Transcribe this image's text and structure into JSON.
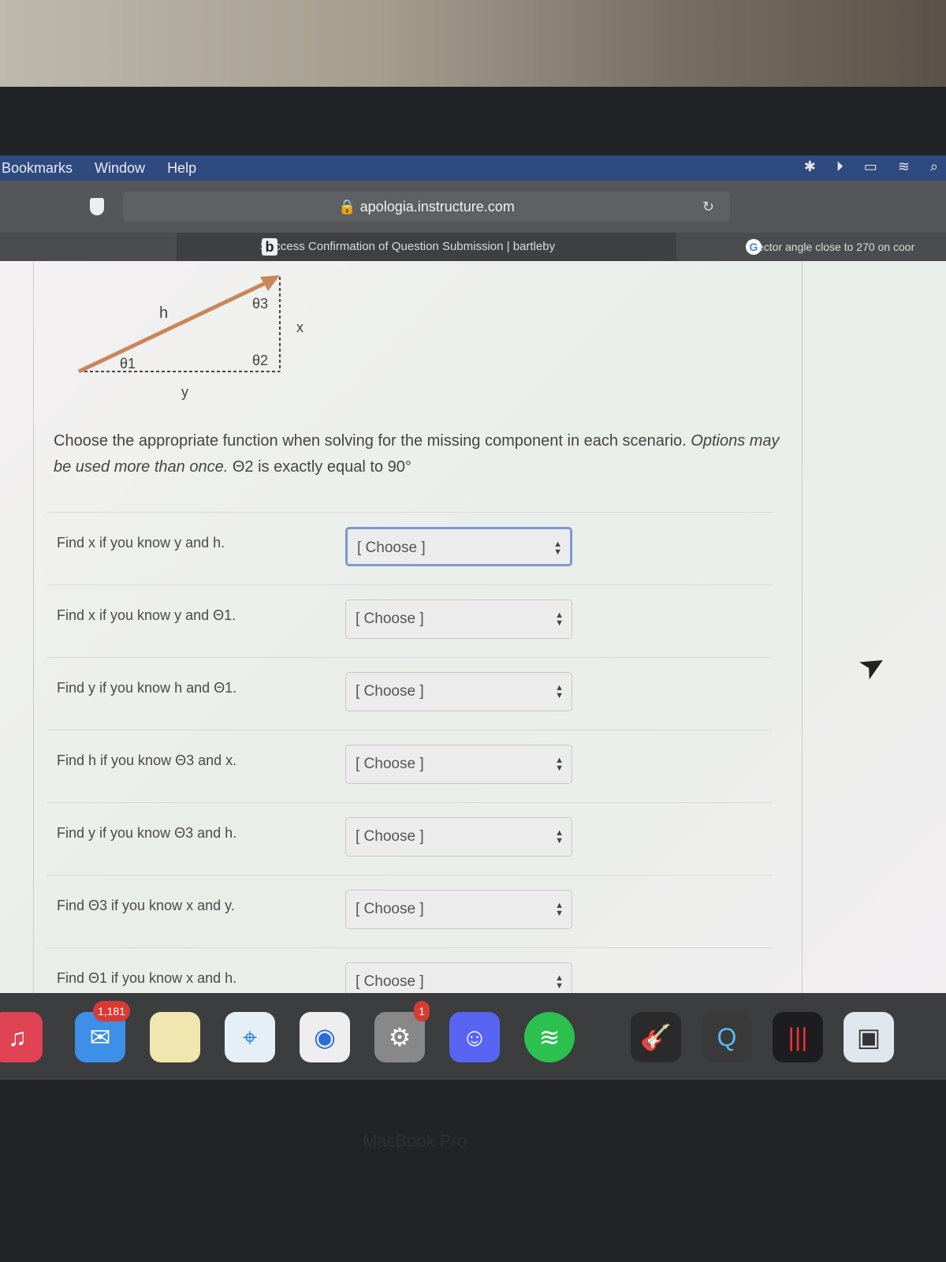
{
  "menubar": {
    "items": [
      "Bookmarks",
      "Window",
      "Help"
    ]
  },
  "browser": {
    "url": "apologia.instructure.com",
    "tabs": [
      {
        "title": "Success Confirmation of Question Submission | bartleby",
        "icon": "b"
      },
      {
        "title": "vector angle close to 270 on coor",
        "icon": "G"
      }
    ]
  },
  "diagram": {
    "h": "h",
    "theta1": "θ1",
    "theta2": "θ2",
    "theta3": "θ3",
    "x": "x",
    "y": "y",
    "arrow_color": "#c8875a"
  },
  "question": {
    "text": "Choose the appropriate function when solving for the missing component in each scenario.",
    "italic": "Options may be used more than once.",
    "tail": "Θ2 is exactly equal to 90°"
  },
  "rows": [
    {
      "label": "Find x if you know y and h.",
      "value": "[ Choose ]"
    },
    {
      "label": "Find x if you know y and Θ1.",
      "value": "[ Choose ]"
    },
    {
      "label": "Find y if you know h and Θ1.",
      "value": "[ Choose ]"
    },
    {
      "label": "Find h if you know Θ3 and x.",
      "value": "[ Choose ]"
    },
    {
      "label": "Find y if you know Θ3 and h.",
      "value": "[ Choose ]"
    },
    {
      "label": "Find Θ3 if you know x and y.",
      "value": "[ Choose ]"
    },
    {
      "label": "Find Θ1 if you know x and h.",
      "value": "[ Choose ]"
    }
  ],
  "dock": {
    "mail_badge": "1,181",
    "settings_badge": "1"
  },
  "bezel_text": "MacBook Pro"
}
